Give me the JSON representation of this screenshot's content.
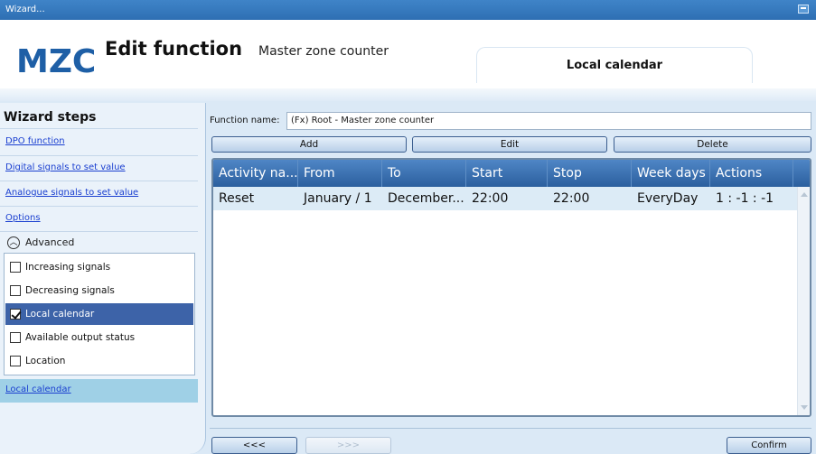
{
  "window": {
    "title": "Wizard..."
  },
  "header": {
    "logo": "MZC",
    "title": "Edit function",
    "subtitle": "Master zone counter",
    "tab_label": "Local calendar"
  },
  "sidebar": {
    "title": "Wizard steps",
    "links": [
      "DPO function",
      "Digital signals to set value",
      "Analogue signals to set value",
      "Options"
    ],
    "advanced_label": "Advanced",
    "checkboxes": [
      {
        "label": "Increasing signals",
        "checked": false
      },
      {
        "label": "Decreasing signals",
        "checked": false
      },
      {
        "label": "Local calendar",
        "checked": true
      },
      {
        "label": "Available output status",
        "checked": false
      },
      {
        "label": "Location",
        "checked": false
      }
    ],
    "selected_step": "Local calendar"
  },
  "form": {
    "function_name_label": "Function name:",
    "function_name_value": "(Fx) Root - Master zone counter"
  },
  "toolbar": {
    "add": "Add",
    "edit": "Edit",
    "delete": "Delete"
  },
  "table": {
    "columns": [
      "Activity na...",
      "From",
      "To",
      "Start",
      "Stop",
      "Week days",
      "Actions"
    ],
    "rows": [
      [
        "Reset",
        "January / 1",
        "December...",
        "22:00",
        "22:00",
        "EveryDay",
        "1 : -1 : -1"
      ]
    ]
  },
  "footer": {
    "back": "<<<",
    "next": ">>>",
    "confirm": "Confirm"
  },
  "colors": {
    "accent": "#2b5f9e",
    "selection": "#3d63a8",
    "link": "#1a3fd0"
  }
}
